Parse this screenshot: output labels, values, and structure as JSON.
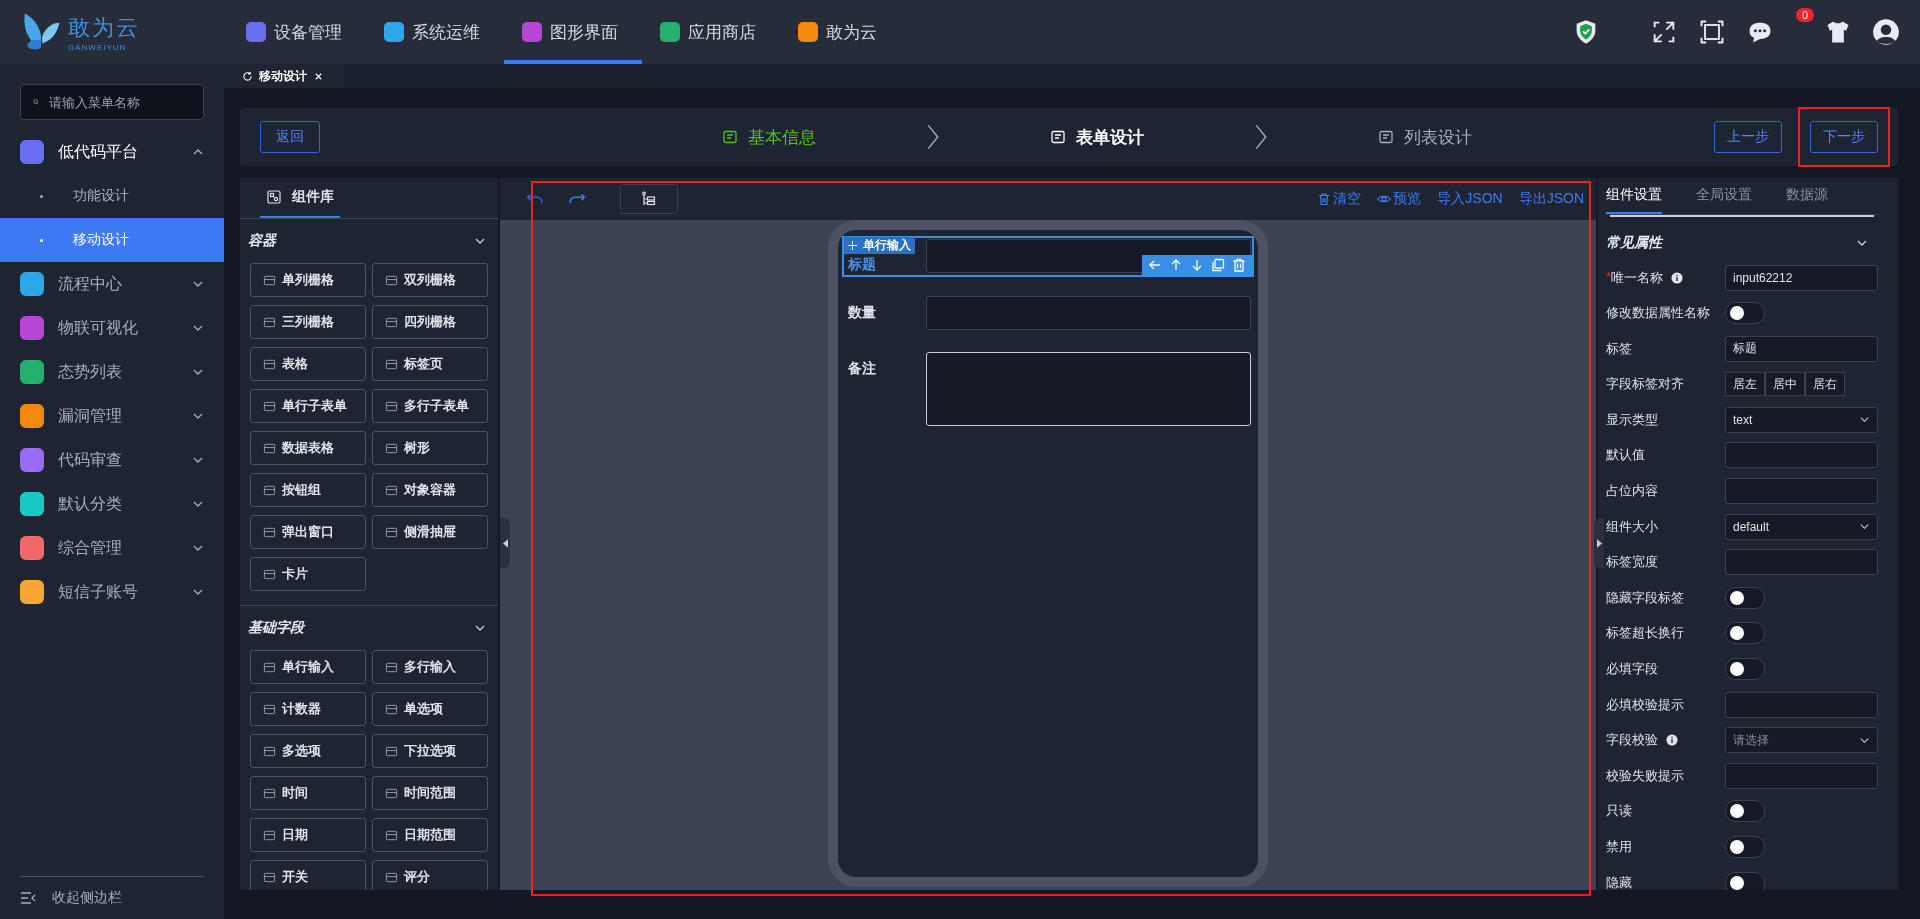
{
  "logo": {
    "name": "敢为云",
    "subtitle": "GANWEIYUN"
  },
  "top_nav": [
    {
      "label": "设备管理",
      "color": "#6a6ff2",
      "selected": false
    },
    {
      "label": "系统运维",
      "color": "#2ea7e8",
      "selected": false
    },
    {
      "label": "图形界面",
      "color": "#b746d6",
      "selected": true
    },
    {
      "label": "应用商店",
      "color": "#25b06f",
      "selected": false
    },
    {
      "label": "敢为云",
      "color": "#f5890f",
      "selected": false
    }
  ],
  "message_count": "0",
  "page_tab": {
    "label": "移动设计"
  },
  "menu_search": {
    "placeholder": "请输入菜单名称"
  },
  "menu": [
    {
      "label": "低代码平台",
      "color": "#6a6ff2",
      "expanded": true,
      "children": [
        {
          "label": "功能设计",
          "selected": false
        },
        {
          "label": "移动设计",
          "selected": true
        }
      ]
    },
    {
      "label": "流程中心",
      "color": "#2ea7e8",
      "expanded": false
    },
    {
      "label": "物联可视化",
      "color": "#b746d6",
      "expanded": false
    },
    {
      "label": "态势列表",
      "color": "#25b06f",
      "expanded": false
    },
    {
      "label": "漏洞管理",
      "color": "#f5890f",
      "expanded": false
    },
    {
      "label": "代码审查",
      "color": "#9a6cf5",
      "expanded": false
    },
    {
      "label": "默认分类",
      "color": "#19c9c4",
      "expanded": false
    },
    {
      "label": "综合管理",
      "color": "#f06a6a",
      "expanded": false
    },
    {
      "label": "短信子账号",
      "color": "#f7a634",
      "expanded": false
    }
  ],
  "collapse_sidebar": "收起侧边栏",
  "steps": {
    "back": "返回",
    "items": [
      {
        "label": "基本信息",
        "completed": true,
        "selected": false
      },
      {
        "label": "表单设计",
        "completed": false,
        "selected": true
      },
      {
        "label": "列表设计",
        "completed": false,
        "selected": false
      }
    ],
    "prev": "上一步",
    "next": "下一步",
    "next_highlighted": true
  },
  "library": {
    "tab": "组件库",
    "groups": [
      {
        "title": "容器",
        "expanded": true,
        "items": [
          "单列栅格",
          "双列栅格",
          "三列栅格",
          "四列栅格",
          "表格",
          "标签页",
          "单行子表单",
          "多行子表单",
          "数据表格",
          "树形",
          "按钮组",
          "对象容器",
          "弹出窗口",
          "侧滑抽屉",
          "卡片"
        ]
      },
      {
        "title": "基础字段",
        "expanded": true,
        "items": [
          "单行输入",
          "多行输入",
          "计数器",
          "单选项",
          "多选项",
          "下拉选项",
          "时间",
          "时间范围",
          "日期",
          "日期范围",
          "开关",
          "评分"
        ]
      }
    ]
  },
  "canvas": {
    "highlighted": true,
    "actions": [
      "清空",
      "预览",
      "导入JSON",
      "导出JSON"
    ],
    "fields": [
      {
        "label": "标题",
        "kind": "input",
        "selected": true,
        "tag": "单行输入"
      },
      {
        "label": "数量",
        "kind": "input",
        "selected": false
      },
      {
        "label": "备注",
        "kind": "textarea",
        "selected": false
      }
    ]
  },
  "settings": {
    "tabs": [
      {
        "label": "组件设置",
        "selected": true
      },
      {
        "label": "全局设置",
        "selected": false
      },
      {
        "label": "数据源",
        "selected": false
      }
    ],
    "section": {
      "title": "常见属性",
      "expanded": true
    },
    "rows": [
      {
        "label": "唯一名称",
        "required_mark": "*",
        "info": true,
        "kind": "input",
        "value": "input62212"
      },
      {
        "label": "修改数据属性名称",
        "kind": "switch",
        "on": false
      },
      {
        "label": "标签",
        "kind": "input",
        "value": "标题"
      },
      {
        "label": "字段标签对齐",
        "kind": "radio",
        "options": [
          {
            "label": "居左",
            "selected": false
          },
          {
            "label": "居中",
            "selected": false
          },
          {
            "label": "居右",
            "selected": false
          }
        ]
      },
      {
        "label": "显示类型",
        "kind": "select",
        "value": "text"
      },
      {
        "label": "默认值",
        "kind": "input"
      },
      {
        "label": "占位内容",
        "kind": "input"
      },
      {
        "label": "组件大小",
        "kind": "select",
        "value": "default"
      },
      {
        "label": "标签宽度",
        "kind": "input"
      },
      {
        "label": "隐藏字段标签",
        "kind": "switch",
        "on": false
      },
      {
        "label": "标签超长换行",
        "kind": "switch",
        "on": false
      },
      {
        "label": "必填字段",
        "kind": "switch",
        "on": false
      },
      {
        "label": "必填校验提示",
        "kind": "input"
      },
      {
        "label": "字段校验",
        "info": true,
        "kind": "select",
        "placeholder": "请选择"
      },
      {
        "label": "校验失败提示",
        "kind": "input"
      },
      {
        "label": "只读",
        "kind": "switch",
        "on": false
      },
      {
        "label": "禁用",
        "kind": "switch",
        "on": false
      },
      {
        "label": "隐藏",
        "kind": "switch",
        "on": false
      }
    ]
  }
}
